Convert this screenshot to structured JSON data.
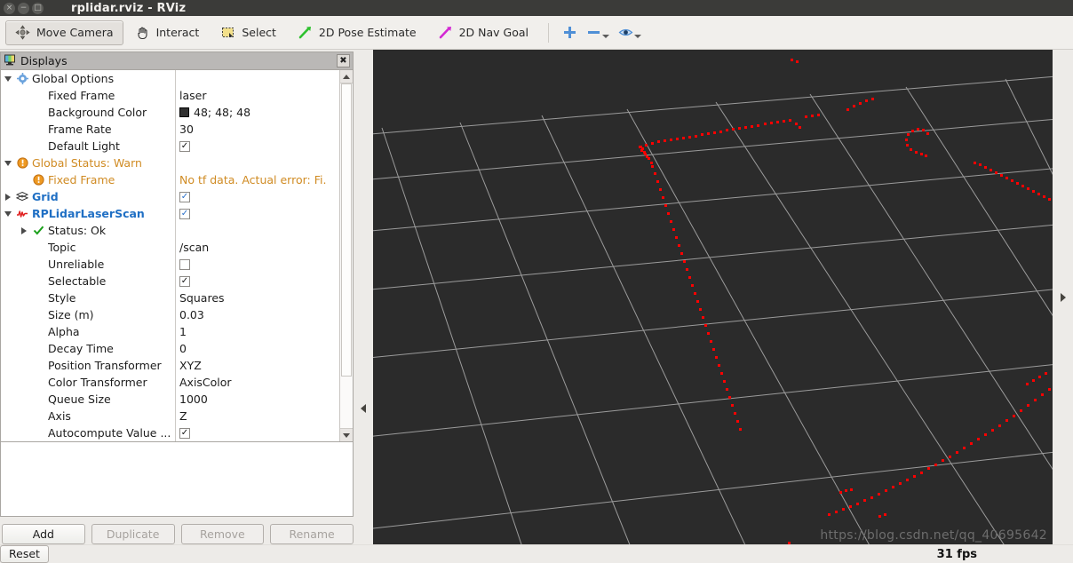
{
  "window": {
    "title": "rplidar.rviz - RViz",
    "buttons": [
      {
        "name": "close",
        "glyph": "×"
      },
      {
        "name": "minimize",
        "glyph": "−"
      },
      {
        "name": "maximize",
        "glyph": "□"
      }
    ]
  },
  "toolbar": {
    "items": [
      {
        "label": "Move Camera",
        "icon": "move-camera-icon",
        "checked": true
      },
      {
        "label": "Interact",
        "icon": "hand-icon",
        "checked": false
      },
      {
        "label": "Select",
        "icon": "select-rect-icon",
        "checked": false
      },
      {
        "label": "2D Pose Estimate",
        "icon": "green-arrow-icon",
        "checked": false
      },
      {
        "label": "2D Nav Goal",
        "icon": "magenta-arrow-icon",
        "checked": false
      }
    ],
    "tools": [
      {
        "name": "add-tool-button",
        "icon": "plus-icon"
      },
      {
        "name": "remove-tool-button",
        "icon": "minus-icon"
      },
      {
        "name": "views-button",
        "icon": "eye-icon"
      }
    ]
  },
  "displays": {
    "panel_title": "Displays",
    "panel_icon": "monitor-icon",
    "close_glyph": "✖",
    "rows": [
      {
        "expander": "down",
        "icon": "gear-icon",
        "label": "Global Options",
        "indent": 0,
        "style": "normal",
        "value_type": "none",
        "value": ""
      },
      {
        "expander": "none",
        "icon": "none",
        "label": "Fixed Frame",
        "indent": 1,
        "style": "normal",
        "value_type": "text",
        "value": "laser"
      },
      {
        "expander": "none",
        "icon": "none",
        "label": "Background Color",
        "indent": 1,
        "style": "normal",
        "value_type": "color",
        "value": "48; 48; 48",
        "swatch": "#303030"
      },
      {
        "expander": "none",
        "icon": "none",
        "label": "Frame Rate",
        "indent": 1,
        "style": "normal",
        "value_type": "text",
        "value": "30"
      },
      {
        "expander": "none",
        "icon": "none",
        "label": "Default Light",
        "indent": 1,
        "style": "normal",
        "value_type": "checkbox-dark",
        "value": "✓"
      },
      {
        "expander": "down",
        "icon": "warn-icon",
        "label": "Global Status: Warn",
        "indent": 0,
        "style": "warn",
        "value_type": "none",
        "value": ""
      },
      {
        "expander": "none",
        "icon": "warn-icon",
        "label": "Fixed Frame",
        "indent": 1,
        "style": "warn",
        "value_type": "text",
        "value": "No tf data.  Actual error: Fi."
      },
      {
        "expander": "right",
        "icon": "grid-icon",
        "label": "Grid",
        "indent": 0,
        "style": "blue",
        "value_type": "checkbox-blue",
        "value": "✓"
      },
      {
        "expander": "down",
        "icon": "laserscan-icon",
        "label": "RPLidarLaserScan",
        "indent": 0,
        "style": "blue",
        "value_type": "checkbox-blue",
        "value": "✓"
      },
      {
        "expander": "right",
        "icon": "ok-icon",
        "label": "Status: Ok",
        "indent": 1,
        "style": "normal",
        "value_type": "none",
        "value": ""
      },
      {
        "expander": "none",
        "icon": "none",
        "label": "Topic",
        "indent": 1,
        "style": "normal",
        "value_type": "text",
        "value": "/scan"
      },
      {
        "expander": "none",
        "icon": "none",
        "label": "Unreliable",
        "indent": 1,
        "style": "normal",
        "value_type": "checkbox-empty",
        "value": ""
      },
      {
        "expander": "none",
        "icon": "none",
        "label": "Selectable",
        "indent": 1,
        "style": "normal",
        "value_type": "checkbox-dark",
        "value": "✓"
      },
      {
        "expander": "none",
        "icon": "none",
        "label": "Style",
        "indent": 1,
        "style": "normal",
        "value_type": "text",
        "value": "Squares"
      },
      {
        "expander": "none",
        "icon": "none",
        "label": "Size (m)",
        "indent": 1,
        "style": "normal",
        "value_type": "text",
        "value": "0.03"
      },
      {
        "expander": "none",
        "icon": "none",
        "label": "Alpha",
        "indent": 1,
        "style": "normal",
        "value_type": "text",
        "value": "1"
      },
      {
        "expander": "none",
        "icon": "none",
        "label": "Decay Time",
        "indent": 1,
        "style": "normal",
        "value_type": "text",
        "value": "0"
      },
      {
        "expander": "none",
        "icon": "none",
        "label": "Position Transformer",
        "indent": 1,
        "style": "normal",
        "value_type": "text",
        "value": "XYZ"
      },
      {
        "expander": "none",
        "icon": "none",
        "label": "Color Transformer",
        "indent": 1,
        "style": "normal",
        "value_type": "text",
        "value": "AxisColor"
      },
      {
        "expander": "none",
        "icon": "none",
        "label": "Queue Size",
        "indent": 1,
        "style": "normal",
        "value_type": "text",
        "value": "1000"
      },
      {
        "expander": "none",
        "icon": "none",
        "label": "Axis",
        "indent": 1,
        "style": "normal",
        "value_type": "text",
        "value": "Z"
      },
      {
        "expander": "none",
        "icon": "none",
        "label": "Autocompute Value ...",
        "indent": 1,
        "style": "normal",
        "value_type": "checkbox-dark",
        "value": "✓"
      }
    ],
    "buttons": [
      {
        "label": "Add",
        "enabled": true
      },
      {
        "label": "Duplicate",
        "enabled": false
      },
      {
        "label": "Remove",
        "enabled": false
      },
      {
        "label": "Rename",
        "enabled": false
      }
    ]
  },
  "view3d": {
    "background_color": "#2b2b2b",
    "grid_color": "#b4b4b4",
    "point_color": "#ff0000",
    "watermark": "https://blog.csdn.net/qq_40695642"
  },
  "statusbar": {
    "reset_label": "Reset",
    "fps": "31 fps"
  }
}
